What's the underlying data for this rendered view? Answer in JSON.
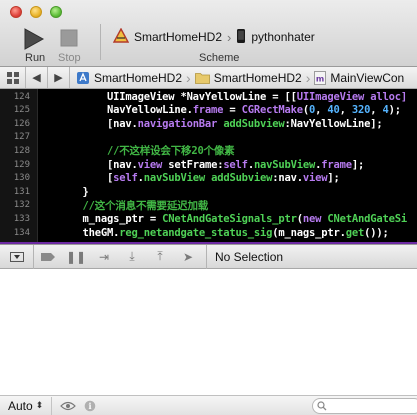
{
  "toolbar": {
    "run_label": "Run",
    "stop_label": "Stop",
    "scheme_label": "Scheme",
    "scheme_target": "SmartHomeHD2",
    "scheme_device": "pythonhater"
  },
  "jumpbar": {
    "crumbs": [
      "SmartHomeHD2",
      "SmartHomeHD2",
      "MainViewCon"
    ]
  },
  "editor": {
    "lines": [
      {
        "num": "124",
        "indent": "        ",
        "tokens": [
          [
            "UIImageView *NavYellowLine = [[",
            "text"
          ],
          [
            "UIImageView alloc]",
            "purple"
          ]
        ]
      },
      {
        "num": "125",
        "indent": "        ",
        "tokens": [
          [
            "NavYellowLine.",
            "text"
          ],
          [
            "frame",
            "purple"
          ],
          [
            " = ",
            "text"
          ],
          [
            "CGRectMake",
            "purple"
          ],
          [
            "(",
            "text"
          ],
          [
            "0",
            "blue"
          ],
          [
            ", ",
            "text"
          ],
          [
            "40",
            "blue"
          ],
          [
            ", ",
            "text"
          ],
          [
            "320",
            "blue"
          ],
          [
            ", ",
            "text"
          ],
          [
            "4",
            "blue"
          ],
          [
            ");",
            "text"
          ]
        ]
      },
      {
        "num": "126",
        "indent": "        ",
        "tokens": [
          [
            "[nav.",
            "text"
          ],
          [
            "navigationBar",
            "purple"
          ],
          [
            " ",
            "text"
          ],
          [
            "addSubview",
            "green"
          ],
          [
            ":NavYellowLine];",
            "text"
          ]
        ]
      },
      {
        "num": "127",
        "indent": "",
        "tokens": []
      },
      {
        "num": "128",
        "indent": "        ",
        "tokens": [
          [
            "//不这样设会下移20个像素",
            "comment"
          ]
        ]
      },
      {
        "num": "129",
        "indent": "        ",
        "tokens": [
          [
            "[nav.",
            "text"
          ],
          [
            "view",
            "purple"
          ],
          [
            " setFrame:",
            "text"
          ],
          [
            "self",
            "purple"
          ],
          [
            ".",
            "text"
          ],
          [
            "navSubView",
            "green"
          ],
          [
            ".",
            "text"
          ],
          [
            "frame",
            "purple"
          ],
          [
            "];",
            "text"
          ]
        ]
      },
      {
        "num": "130",
        "indent": "        ",
        "tokens": [
          [
            "[",
            "text"
          ],
          [
            "self",
            "purple"
          ],
          [
            ".",
            "text"
          ],
          [
            "navSubView",
            "green"
          ],
          [
            " ",
            "text"
          ],
          [
            "addSubview",
            "green"
          ],
          [
            ":nav.",
            "text"
          ],
          [
            "view",
            "purple"
          ],
          [
            "];",
            "text"
          ]
        ]
      },
      {
        "num": "131",
        "indent": "    ",
        "tokens": [
          [
            "}",
            "text"
          ]
        ]
      },
      {
        "num": "132",
        "indent": "    ",
        "tokens": [
          [
            "//这个消息不需要延迟加载",
            "comment"
          ]
        ]
      },
      {
        "num": "133",
        "indent": "    ",
        "tokens": [
          [
            "m_nags_ptr = ",
            "text"
          ],
          [
            "CNetAndGateSignals_ptr",
            "green"
          ],
          [
            "(",
            "text"
          ],
          [
            "new",
            "purple"
          ],
          [
            " ",
            "text"
          ],
          [
            "CNetAndGateSi",
            "green"
          ]
        ]
      },
      {
        "num": "134",
        "indent": "    ",
        "tokens": [
          [
            "theGM.",
            "text"
          ],
          [
            "reg_netandgate_status_sig",
            "green"
          ],
          [
            "(m_nags_ptr.",
            "text"
          ],
          [
            "get",
            "green"
          ],
          [
            "());",
            "text"
          ]
        ]
      }
    ]
  },
  "debugbar": {
    "no_selection": "No Selection"
  },
  "bottombar": {
    "auto_label": "Auto"
  },
  "colors": {
    "editor_bg": "#000000",
    "comment": "#41b645",
    "keyword": "#b77bf0",
    "number": "#55b4ff",
    "method": "#4fd156"
  }
}
